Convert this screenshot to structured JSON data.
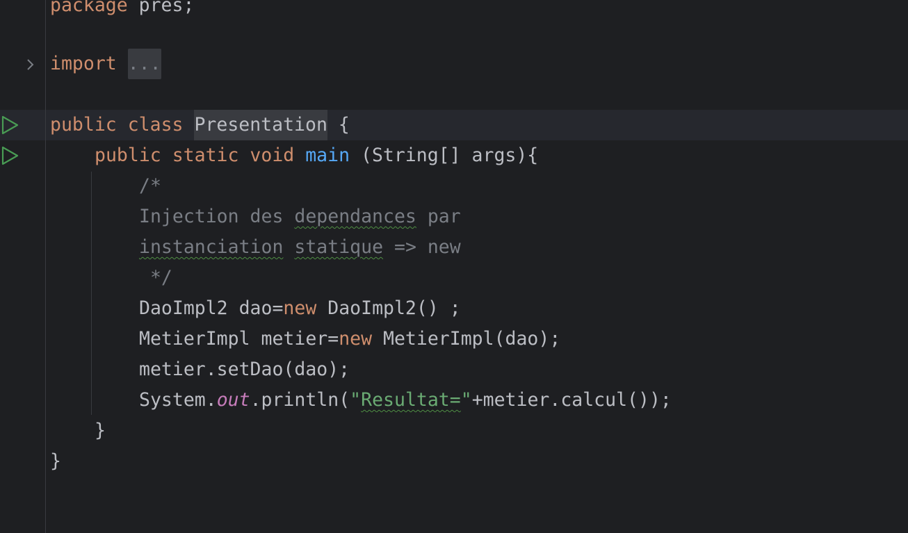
{
  "editor": {
    "language": "Java",
    "accent_colors": {
      "keyword": "#cf8e6d",
      "method": "#56a8f5",
      "comment": "#7a7e85",
      "string": "#6aab73",
      "static_field": "#c77dbb",
      "run_icon": "#499c54"
    },
    "gutter": {
      "run_class_icon": "run-gutter-icon",
      "run_main_icon": "run-gutter-icon",
      "fold_icon": "chevron-right-icon"
    },
    "code": {
      "package_kw": "package",
      "package_name": " pres;",
      "import_kw": "import",
      "import_fold": "...",
      "public_kw": "public",
      "class_kw": "class",
      "class_name": "Presentation",
      "class_open": "{",
      "static_kw": "static",
      "void_kw": "void",
      "main_name": "main",
      "main_params": " (String[] args){",
      "comment_open": "/*",
      "comment_l1_a": "Injection des ",
      "comment_l1_b": "dependances",
      "comment_l1_c": " par",
      "comment_l2_a": "instanciation",
      "comment_l2_b": " ",
      "comment_l2_c": "statique",
      "comment_l2_d": " => new",
      "comment_close": " */",
      "dao_decl": "DaoImpl2 dao=",
      "new_kw": "new",
      "dao_ctor": " DaoImpl2() ;",
      "metier_decl": "MetierImpl metier=",
      "metier_ctor": " MetierImpl(dao);",
      "set_dao": "metier.setDao(dao);",
      "system": "System.",
      "out_field": "out",
      "println": ".println(",
      "str_quote_open": "\"",
      "str_word": "Resultat=",
      "str_quote_close": "\"",
      "println_rest": "+metier.calcul());",
      "method_close": "}",
      "class_close": "}"
    }
  }
}
